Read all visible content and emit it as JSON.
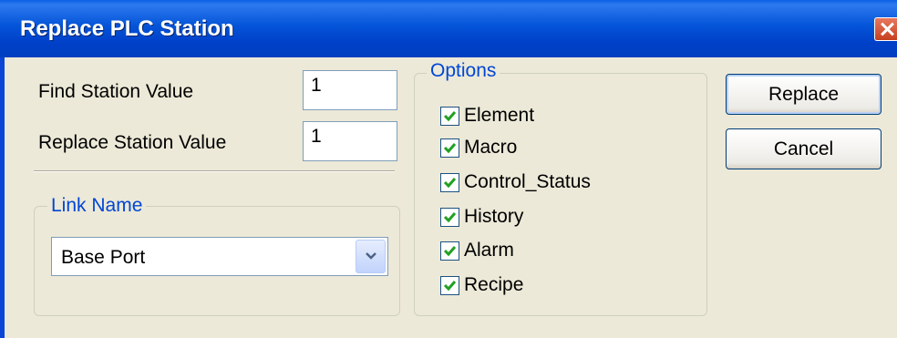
{
  "window": {
    "title": "Replace PLC Station"
  },
  "fields": {
    "find_label": "Find Station Value",
    "find_value": "1",
    "replace_label": "Replace Station Value",
    "replace_value": "1"
  },
  "link_group": {
    "legend": "Link Name",
    "selected": "Base Port"
  },
  "options": {
    "legend": "Options",
    "items": [
      {
        "label": "Element",
        "checked": true
      },
      {
        "label": "Macro",
        "checked": true
      },
      {
        "label": "Control_Status",
        "checked": true
      },
      {
        "label": "History",
        "checked": true
      },
      {
        "label": "Alarm",
        "checked": true
      },
      {
        "label": "Recipe",
        "checked": true
      }
    ]
  },
  "buttons": {
    "replace": "Replace",
    "cancel": "Cancel"
  },
  "colors": {
    "titlebar": "#0454d8",
    "legend_text": "#0046d5",
    "check_mark": "#21a121",
    "dialog_bg": "#ece9d8"
  }
}
